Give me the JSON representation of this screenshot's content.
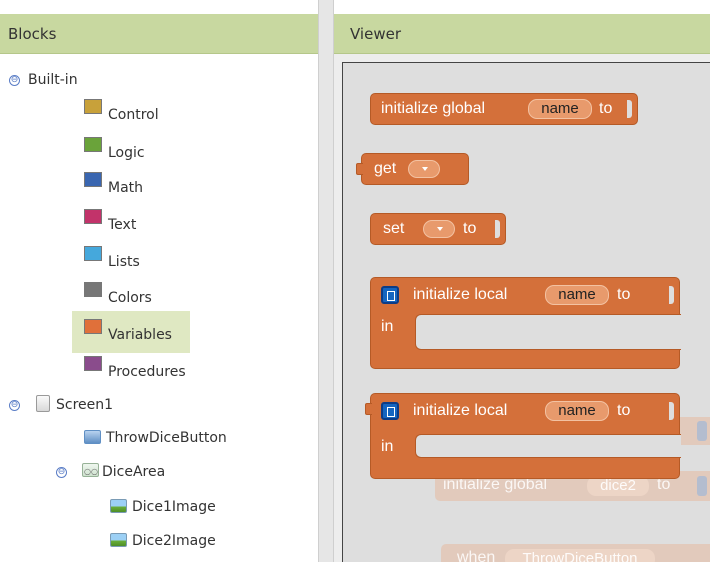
{
  "blocks_panel": {
    "title": "Blocks",
    "builtin_label": "Built-in",
    "builtin_items": [
      {
        "label": "Control",
        "color": "#c8a13a"
      },
      {
        "label": "Logic",
        "color": "#6aa33a"
      },
      {
        "label": "Math",
        "color": "#3a66b0"
      },
      {
        "label": "Text",
        "color": "#c2336a"
      },
      {
        "label": "Lists",
        "color": "#45a8dc"
      },
      {
        "label": "Colors",
        "color": "#777777"
      },
      {
        "label": "Variables",
        "color": "#e0703a"
      },
      {
        "label": "Procedures",
        "color": "#8a4c8c"
      }
    ],
    "components": {
      "screen": "Screen1",
      "throw_button": "ThrowDiceButton",
      "dice_area": "DiceArea",
      "dice1": "Dice1Image",
      "dice2": "Dice2Image"
    },
    "toggle_symbol": "⊖"
  },
  "viewer": {
    "title": "Viewer",
    "block1": {
      "prefix": "initialize global",
      "name": "name",
      "suffix": "to"
    },
    "block2": {
      "label": "get"
    },
    "block3": {
      "label": "set",
      "suffix": "to"
    },
    "block4": {
      "prefix": "initialize local",
      "name": "name",
      "suffix": "to",
      "in_label": "in"
    },
    "block5": {
      "prefix": "initialize local",
      "name": "name",
      "suffix": "to",
      "in_label": "in"
    },
    "ghost_block1": {
      "prefix": "initialize global",
      "name": "dice2",
      "suffix": "to"
    },
    "ghost_block2": {
      "prefix": "when",
      "name": "ThrowDiceButton"
    }
  }
}
